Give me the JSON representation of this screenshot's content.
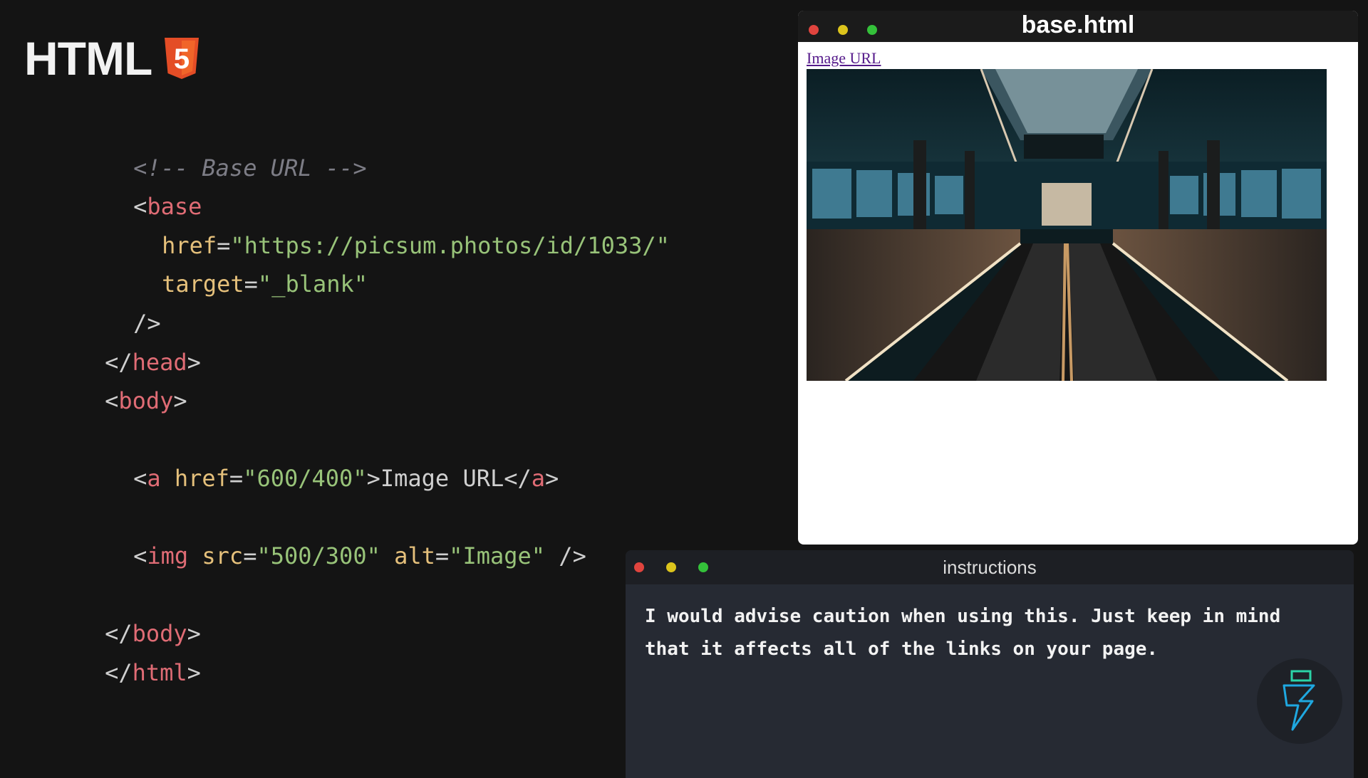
{
  "logo": {
    "text": "HTML",
    "shield_digit": "5",
    "shield_color": "#e44d26"
  },
  "code": {
    "lines": [
      "<!-- Base URL -->",
      "<base",
      "href=\"https://picsum.photos/id/1033/\"",
      "target=\"_blank\"",
      "/>",
      "</head>",
      "<body>",
      "<a href=\"600/400\">Image URL</a>",
      "<img src=\"500/300\" alt=\"Image\" />",
      "</body>",
      "</html>"
    ],
    "comment": "<!-- Base URL -->",
    "base_tag": "base",
    "base_href_attr": "href",
    "base_href_value": "\"https://picsum.photos/id/1033/\"",
    "base_target_attr": "target",
    "base_target_value": "\"_blank\"",
    "self_close": "/>",
    "head_close_tag": "head",
    "body_open_tag": "body",
    "a_tag": "a",
    "a_href_attr": "href",
    "a_href_value": "\"600/400\"",
    "a_text": "Image URL",
    "img_tag": "img",
    "img_src_attr": "src",
    "img_src_value": "\"500/300\"",
    "img_alt_attr": "alt",
    "img_alt_value": "\"Image\"",
    "body_close_tag": "body",
    "html_close_tag": "html"
  },
  "browser": {
    "title": "base.html",
    "link_text": "Image URL",
    "image_alt": "Image"
  },
  "instructions": {
    "title": "instructions",
    "text": "I would advise caution when using this. Just keep in mind that it affects all of the links on your page."
  },
  "colors": {
    "background": "#141414",
    "tag": "#e06c75",
    "attribute": "#e5c07b",
    "string": "#98c379",
    "comment": "#7d7d86",
    "link": "#551a8b"
  }
}
